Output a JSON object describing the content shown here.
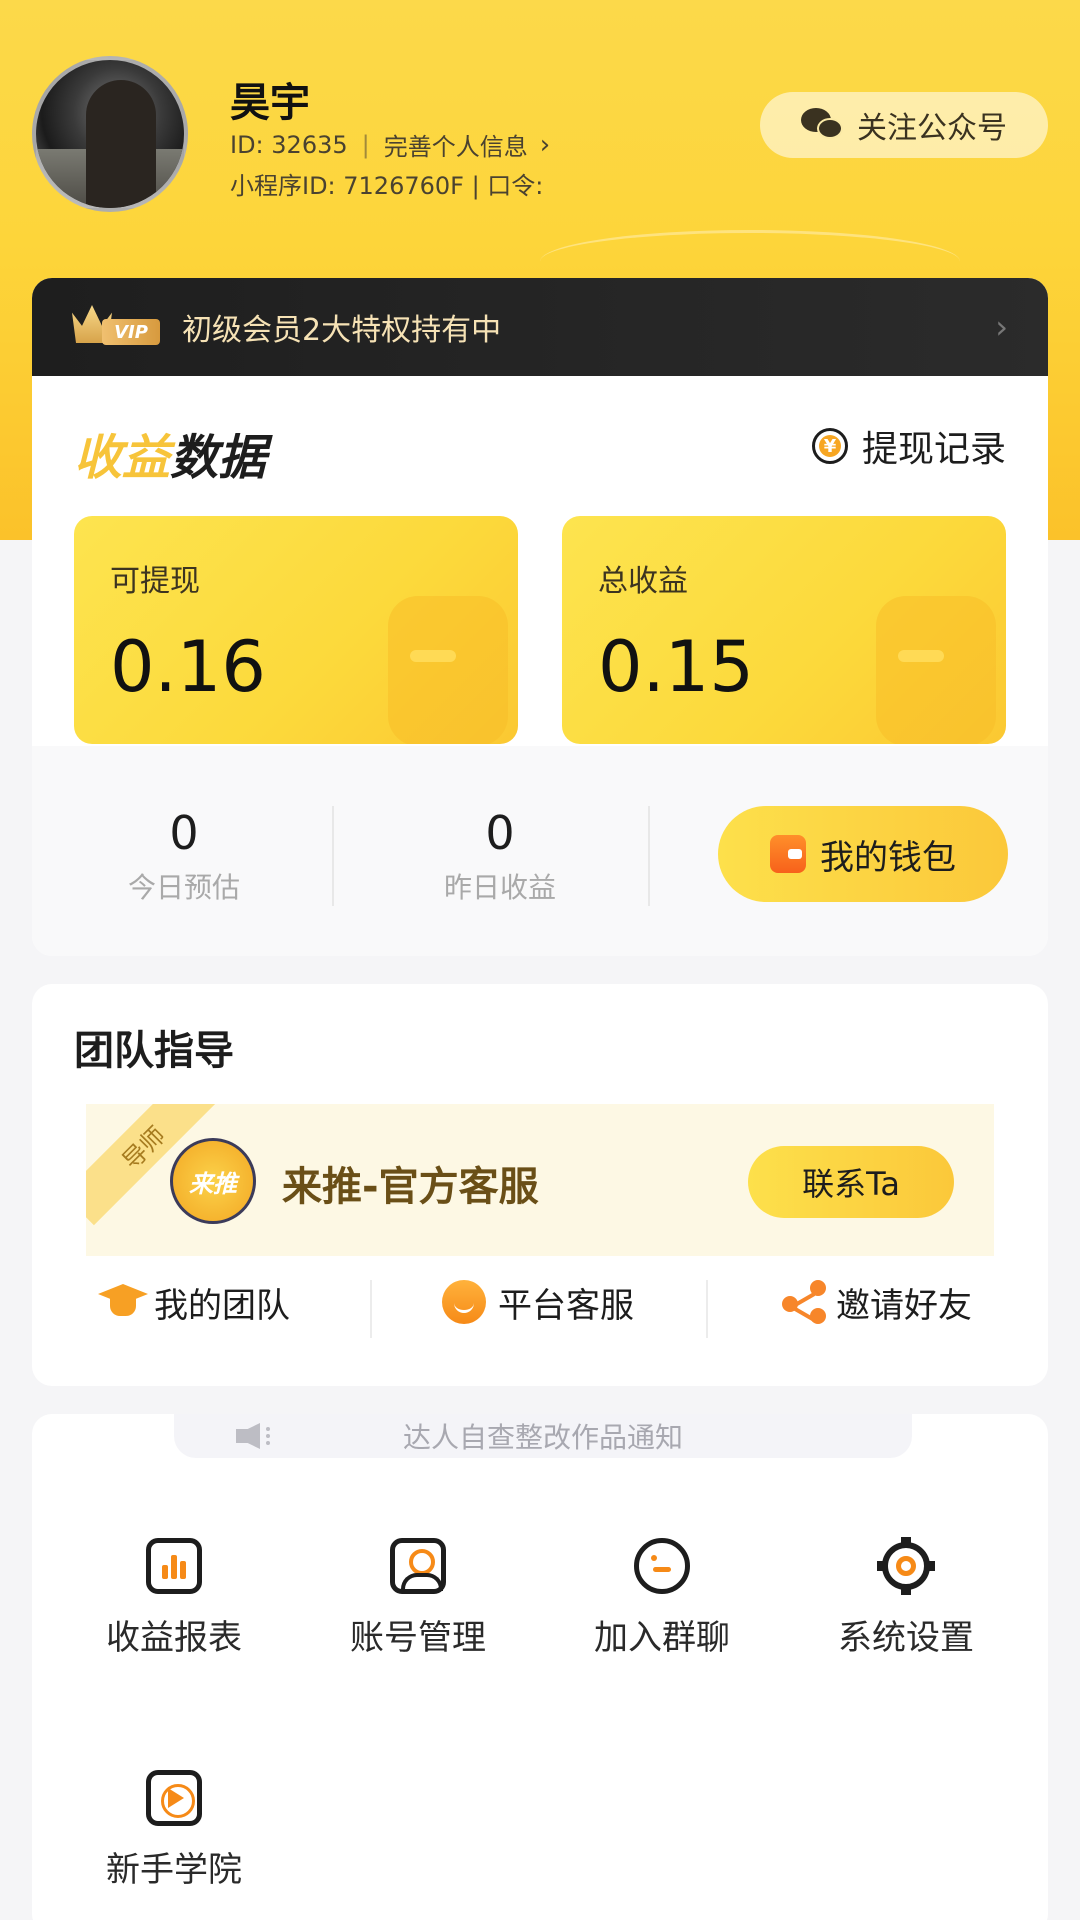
{
  "profile": {
    "name": "昊宇",
    "id_text": "ID: 32635",
    "separator": "|",
    "complete_info": "完善个人信息",
    "mini_program_text": "小程序ID: 7126760F | 口令:",
    "follow_label": "关注公众号"
  },
  "vip": {
    "badge": "VIP",
    "text": "初级会员2大特权持有中"
  },
  "income": {
    "title_highlight": "收益",
    "title_rest": "数据",
    "withdraw_record": "提现记录",
    "withdrawable_label": "可提现",
    "withdrawable_value": "0.16",
    "total_label": "总收益",
    "total_value": "0.15",
    "today_value": "0",
    "today_label": "今日预估",
    "yesterday_value": "0",
    "yesterday_label": "昨日收益",
    "wallet_label": "我的钱包"
  },
  "team": {
    "title": "团队指导",
    "mentor_ribbon": "导师",
    "mentor_logo": "来推",
    "mentor_name": "来推-官方客服",
    "contact_label": "联系Ta",
    "quick": [
      "我的团队",
      "平台客服",
      "邀请好友"
    ]
  },
  "notice": {
    "text": "达人自查整改作品通知"
  },
  "grid": [
    "收益报表",
    "账号管理",
    "加入群聊",
    "系统设置",
    "新手学院"
  ],
  "colors": {
    "brand_yellow": "#fcd93b",
    "accent_orange": "#f68a17",
    "vip_gold": "#f6e2b5"
  }
}
